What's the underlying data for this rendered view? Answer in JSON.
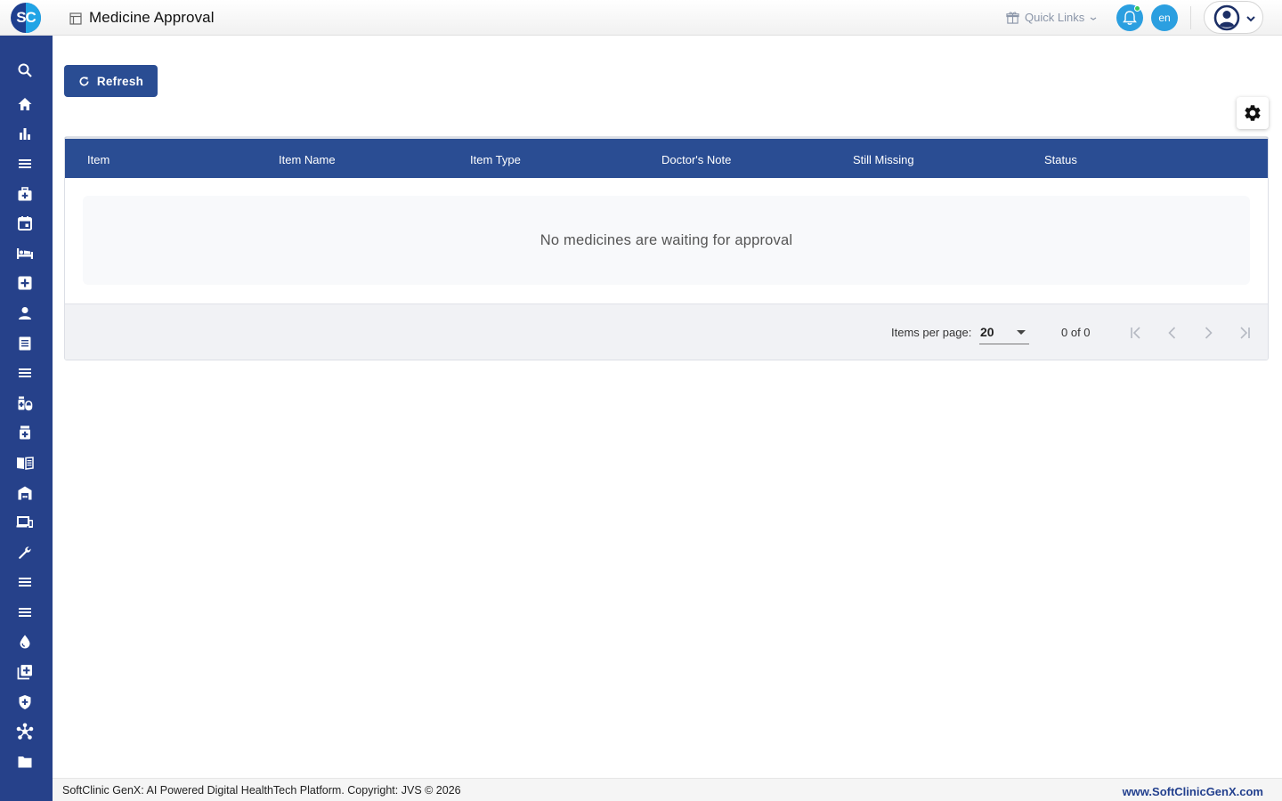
{
  "header": {
    "logo_text": "SC",
    "page_title": "Medicine Approval",
    "quick_links_label": "Quick Links",
    "language_label": "en"
  },
  "sidebar": {
    "items": [
      {
        "icon": "search-icon"
      },
      {
        "icon": "home-icon"
      },
      {
        "icon": "bar-chart-icon"
      },
      {
        "icon": "menu-icon"
      },
      {
        "icon": "medical-bag-icon"
      },
      {
        "icon": "calendar-icon"
      },
      {
        "icon": "bed-icon"
      },
      {
        "icon": "plus-box-icon"
      },
      {
        "icon": "person-icon"
      },
      {
        "icon": "document-icon"
      },
      {
        "icon": "menu-icon"
      },
      {
        "icon": "medication-icon"
      },
      {
        "icon": "medicine-bottle-icon"
      },
      {
        "icon": "book-icon"
      },
      {
        "icon": "warehouse-icon"
      },
      {
        "icon": "devices-icon"
      },
      {
        "icon": "wrench-icon"
      },
      {
        "icon": "menu-icon"
      },
      {
        "icon": "menu-icon"
      },
      {
        "icon": "blood-drop-icon"
      },
      {
        "icon": "library-add-icon"
      },
      {
        "icon": "shield-plus-icon"
      },
      {
        "icon": "hub-icon"
      },
      {
        "icon": "folder-icon"
      }
    ]
  },
  "toolbar": {
    "refresh_label": "Refresh"
  },
  "table": {
    "columns": [
      "Item",
      "Item Name",
      "Item Type",
      "Doctor's Note",
      "Still Missing",
      "Status"
    ],
    "empty_message": "No medicines are waiting for approval"
  },
  "pagination": {
    "items_per_page_label": "Items per page:",
    "items_per_page_value": "20",
    "range_label": "0 of 0"
  },
  "footer": {
    "copyright": "SoftClinic GenX: AI Powered Digital HealthTech Platform. Copyright: JVS © 2026",
    "website": "www.SoftClinicGenX.com"
  },
  "colors": {
    "primary": "#2a4d93",
    "sidebar": "#26418a",
    "accent": "#2b9fe0"
  }
}
